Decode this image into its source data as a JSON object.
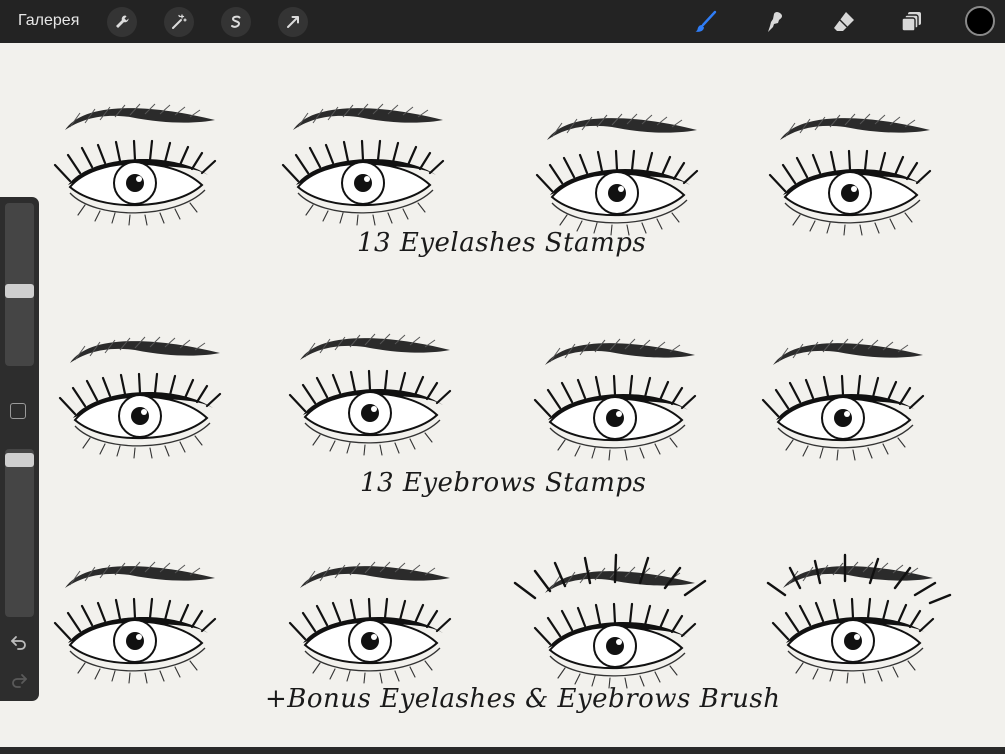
{
  "toolbar": {
    "gallery_label": "Галерея",
    "left_tools": [
      "wrench-icon",
      "magic-wand-icon",
      "selection-icon",
      "transform-arrow-icon"
    ],
    "right_tools": [
      "brush-icon",
      "smudge-icon",
      "eraser-icon",
      "layers-icon"
    ],
    "active_tool": "brush-icon",
    "accent_color": "#2f7df6",
    "current_color": "#000000"
  },
  "sidebar": {
    "brush_size_level": 0.5,
    "opacity_level": 1.0,
    "icons": [
      "modify-button",
      "undo-icon",
      "redo-icon"
    ]
  },
  "canvas": {
    "captions": {
      "eyelashes": "13 Eyelashes Stamps",
      "eyebrows": "13 Eyebrows Stamps",
      "bonus": "+Bonus Eyelashes & Eyebrows Brush"
    }
  }
}
